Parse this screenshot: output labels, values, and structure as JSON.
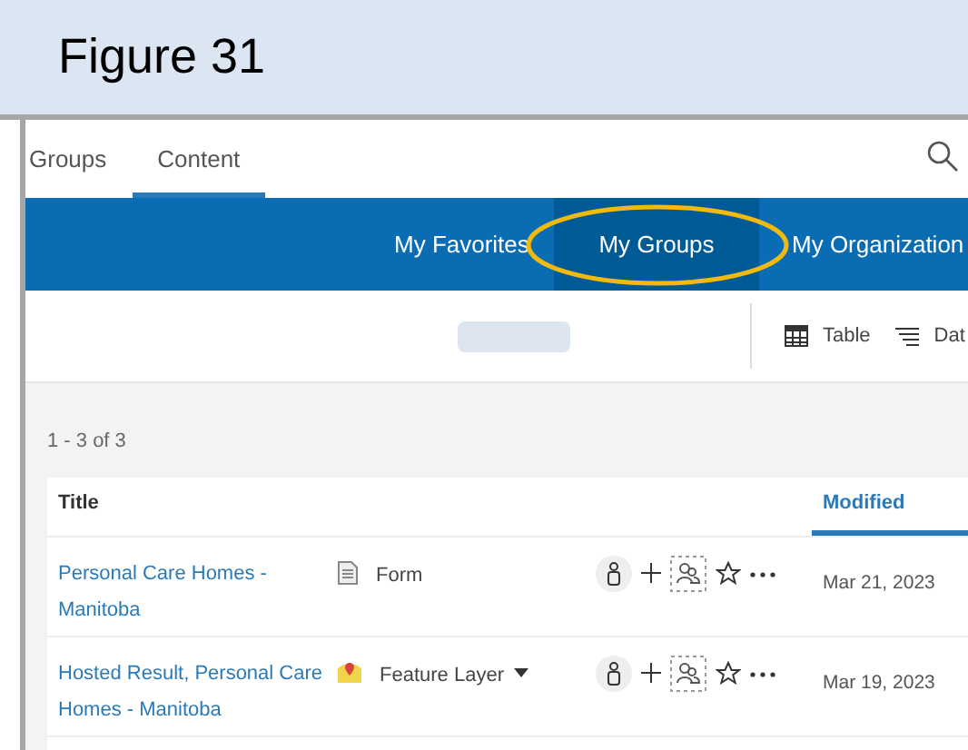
{
  "figure_label": "Figure 31",
  "nav_tabs": [
    {
      "label": "Groups",
      "selected": false
    },
    {
      "label": "Content",
      "selected": true
    }
  ],
  "filter_tabs": [
    {
      "label": "My Favorites",
      "selected": false
    },
    {
      "label": "My Groups",
      "selected": true
    },
    {
      "label": "My Organization",
      "selected": false
    }
  ],
  "view_controls": [
    {
      "kind": "table",
      "label": "Table"
    },
    {
      "kind": "sort",
      "label": "Dat"
    }
  ],
  "result_count": "1 - 3 of 3",
  "table": {
    "columns": [
      {
        "label": "Title",
        "sorted": false
      },
      {
        "label": "Modified",
        "sorted": true
      }
    ],
    "rows": [
      {
        "title": "Personal Care Homes - Manitoba",
        "type": "Form",
        "kind": "form",
        "has_dropdown": false,
        "modified": "Mar 21, 2023"
      },
      {
        "title": "Hosted Result, Personal Care Homes - Manitoba",
        "type": "Feature Layer",
        "kind": "layer",
        "has_dropdown": true,
        "modified": "Mar 19, 2023"
      }
    ]
  }
}
